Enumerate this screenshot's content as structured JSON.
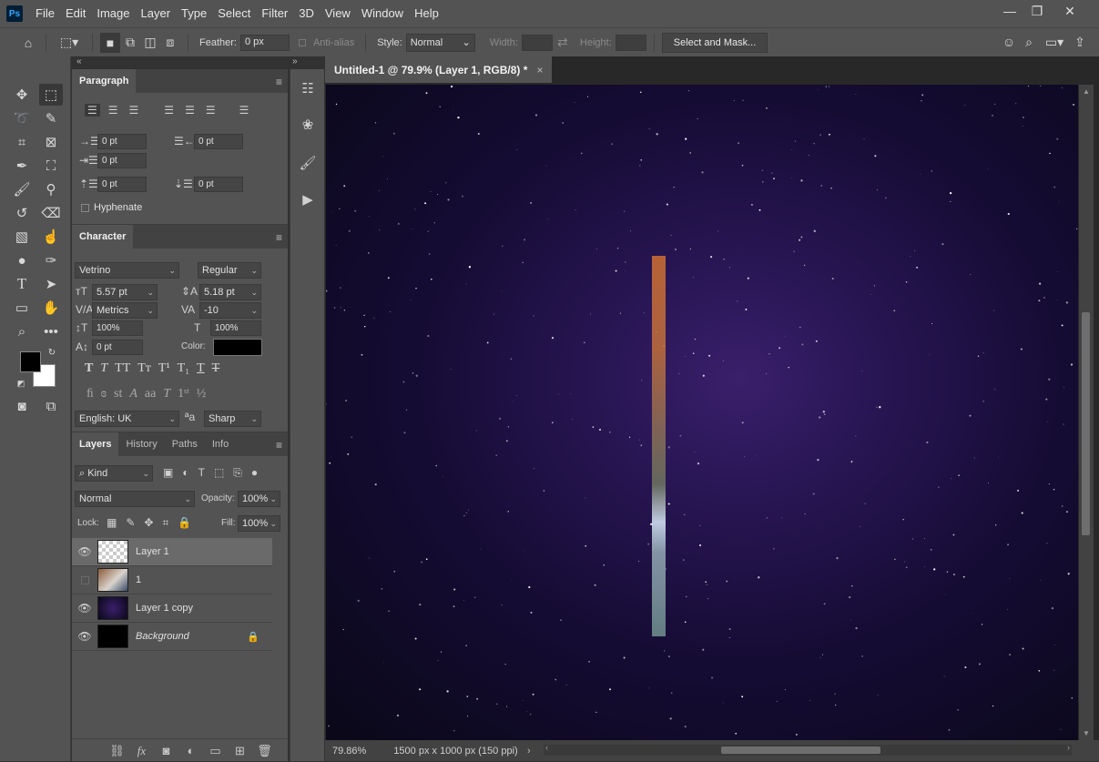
{
  "menubar": {
    "logo": "Ps",
    "items": [
      "File",
      "Edit",
      "Image",
      "Layer",
      "Type",
      "Select",
      "Filter",
      "3D",
      "View",
      "Window",
      "Help"
    ],
    "window_controls": [
      "—",
      "❐",
      "✕"
    ]
  },
  "options": {
    "feather_label": "Feather:",
    "feather_value": "0 px",
    "antialias_label": "Anti-alias",
    "style_label": "Style:",
    "style_value": "Normal",
    "width_label": "Width:",
    "height_label": "Height:",
    "select_mask_label": "Select and Mask..."
  },
  "paragraph": {
    "tab": "Paragraph",
    "indent_left": "0 pt",
    "indent_right": "0 pt",
    "indent_first": "0 pt",
    "space_before": "0 pt",
    "space_after": "0 pt",
    "hyphenate_label": "Hyphenate"
  },
  "character": {
    "tab": "Character",
    "font_family": "Vetrino",
    "font_style": "Regular",
    "font_size": "5.57 pt",
    "leading": "5.18 pt",
    "kerning": "Metrics",
    "tracking": "-10",
    "vscale": "100%",
    "hscale": "100%",
    "baseline": "0 pt",
    "color_label": "Color:",
    "color_value": "#000000",
    "language": "English: UK",
    "antialias_method": "Sharp",
    "aa_glyph": "ªa"
  },
  "layers_panel": {
    "tabs": [
      "Layers",
      "History",
      "Paths",
      "Info"
    ],
    "filter_kind": "Kind",
    "blend_mode": "Normal",
    "opacity_label": "Opacity:",
    "opacity_value": "100%",
    "lock_label": "Lock:",
    "fill_label": "Fill:",
    "fill_value": "100%",
    "layers": [
      {
        "name": "Layer 1",
        "visible": true,
        "selected": true
      },
      {
        "name": "1",
        "visible": false,
        "selected": false
      },
      {
        "name": "Layer 1 copy",
        "visible": true,
        "selected": false
      },
      {
        "name": "Background",
        "visible": true,
        "selected": false,
        "locked": true
      }
    ]
  },
  "document": {
    "tab_title": "Untitled-1 @ 79.9% (Layer 1, RGB/8) *",
    "zoom": "79.86%",
    "doc_info": "1500 px x 1000 px (150 ppi)"
  },
  "colors": {
    "foreground": "#000000",
    "background": "#ffffff",
    "ui_panel": "#535353",
    "canvas_space": "#150c34"
  }
}
